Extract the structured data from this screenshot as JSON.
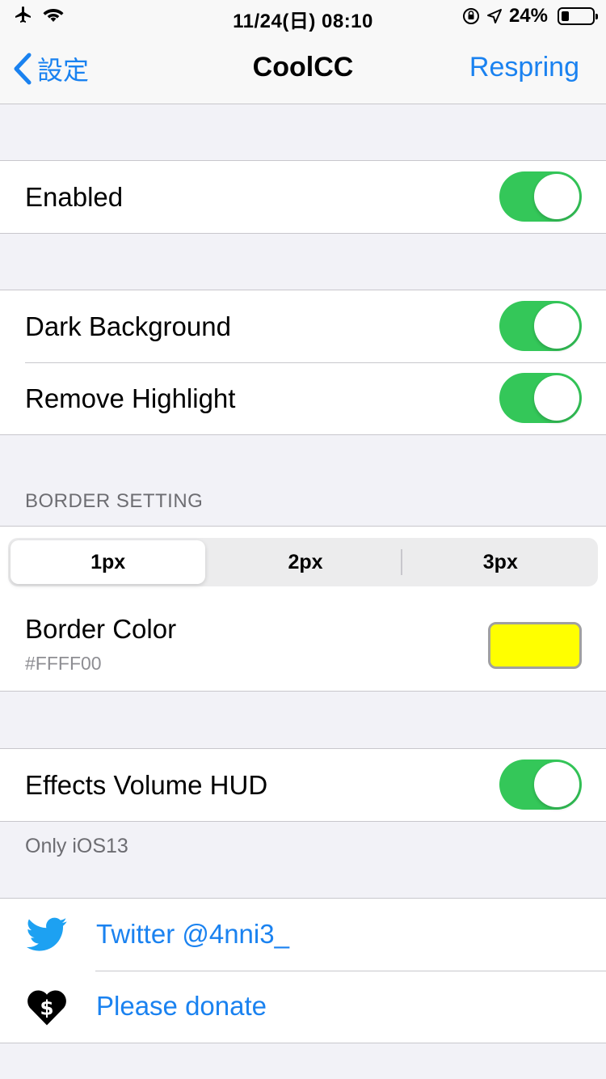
{
  "status_bar": {
    "time": "11/24(日) 08:10",
    "battery": "24%",
    "icons": [
      "airplane-icon",
      "wifi-icon",
      "orientation-lock-icon",
      "location-icon",
      "battery-icon"
    ]
  },
  "nav": {
    "back_label": "設定",
    "title": "CoolCC",
    "right_label": "Respring"
  },
  "groups": {
    "enabled": {
      "label": "Enabled",
      "on": true
    },
    "appearance": [
      {
        "label": "Dark Background",
        "on": true
      },
      {
        "label": "Remove Highlight",
        "on": true
      }
    ],
    "border": {
      "header": "BORDER SETTING",
      "segments": [
        "1px",
        "2px",
        "3px"
      ],
      "selected": "1px",
      "color_label": "Border Color",
      "color_value": "#FFFF00"
    },
    "volume": {
      "label": "Effects Volume HUD",
      "on": true,
      "footer": "Only iOS13"
    },
    "links": [
      {
        "label": "Twitter @4nni3_",
        "icon": "twitter-bird-icon"
      },
      {
        "label": "Please donate",
        "icon": "heart-dollar-icon"
      }
    ]
  },
  "colors": {
    "accent": "#1a82f0",
    "toggle_on": "#34c759",
    "background": "#f2f2f7",
    "swatch": "#FFFF00"
  }
}
